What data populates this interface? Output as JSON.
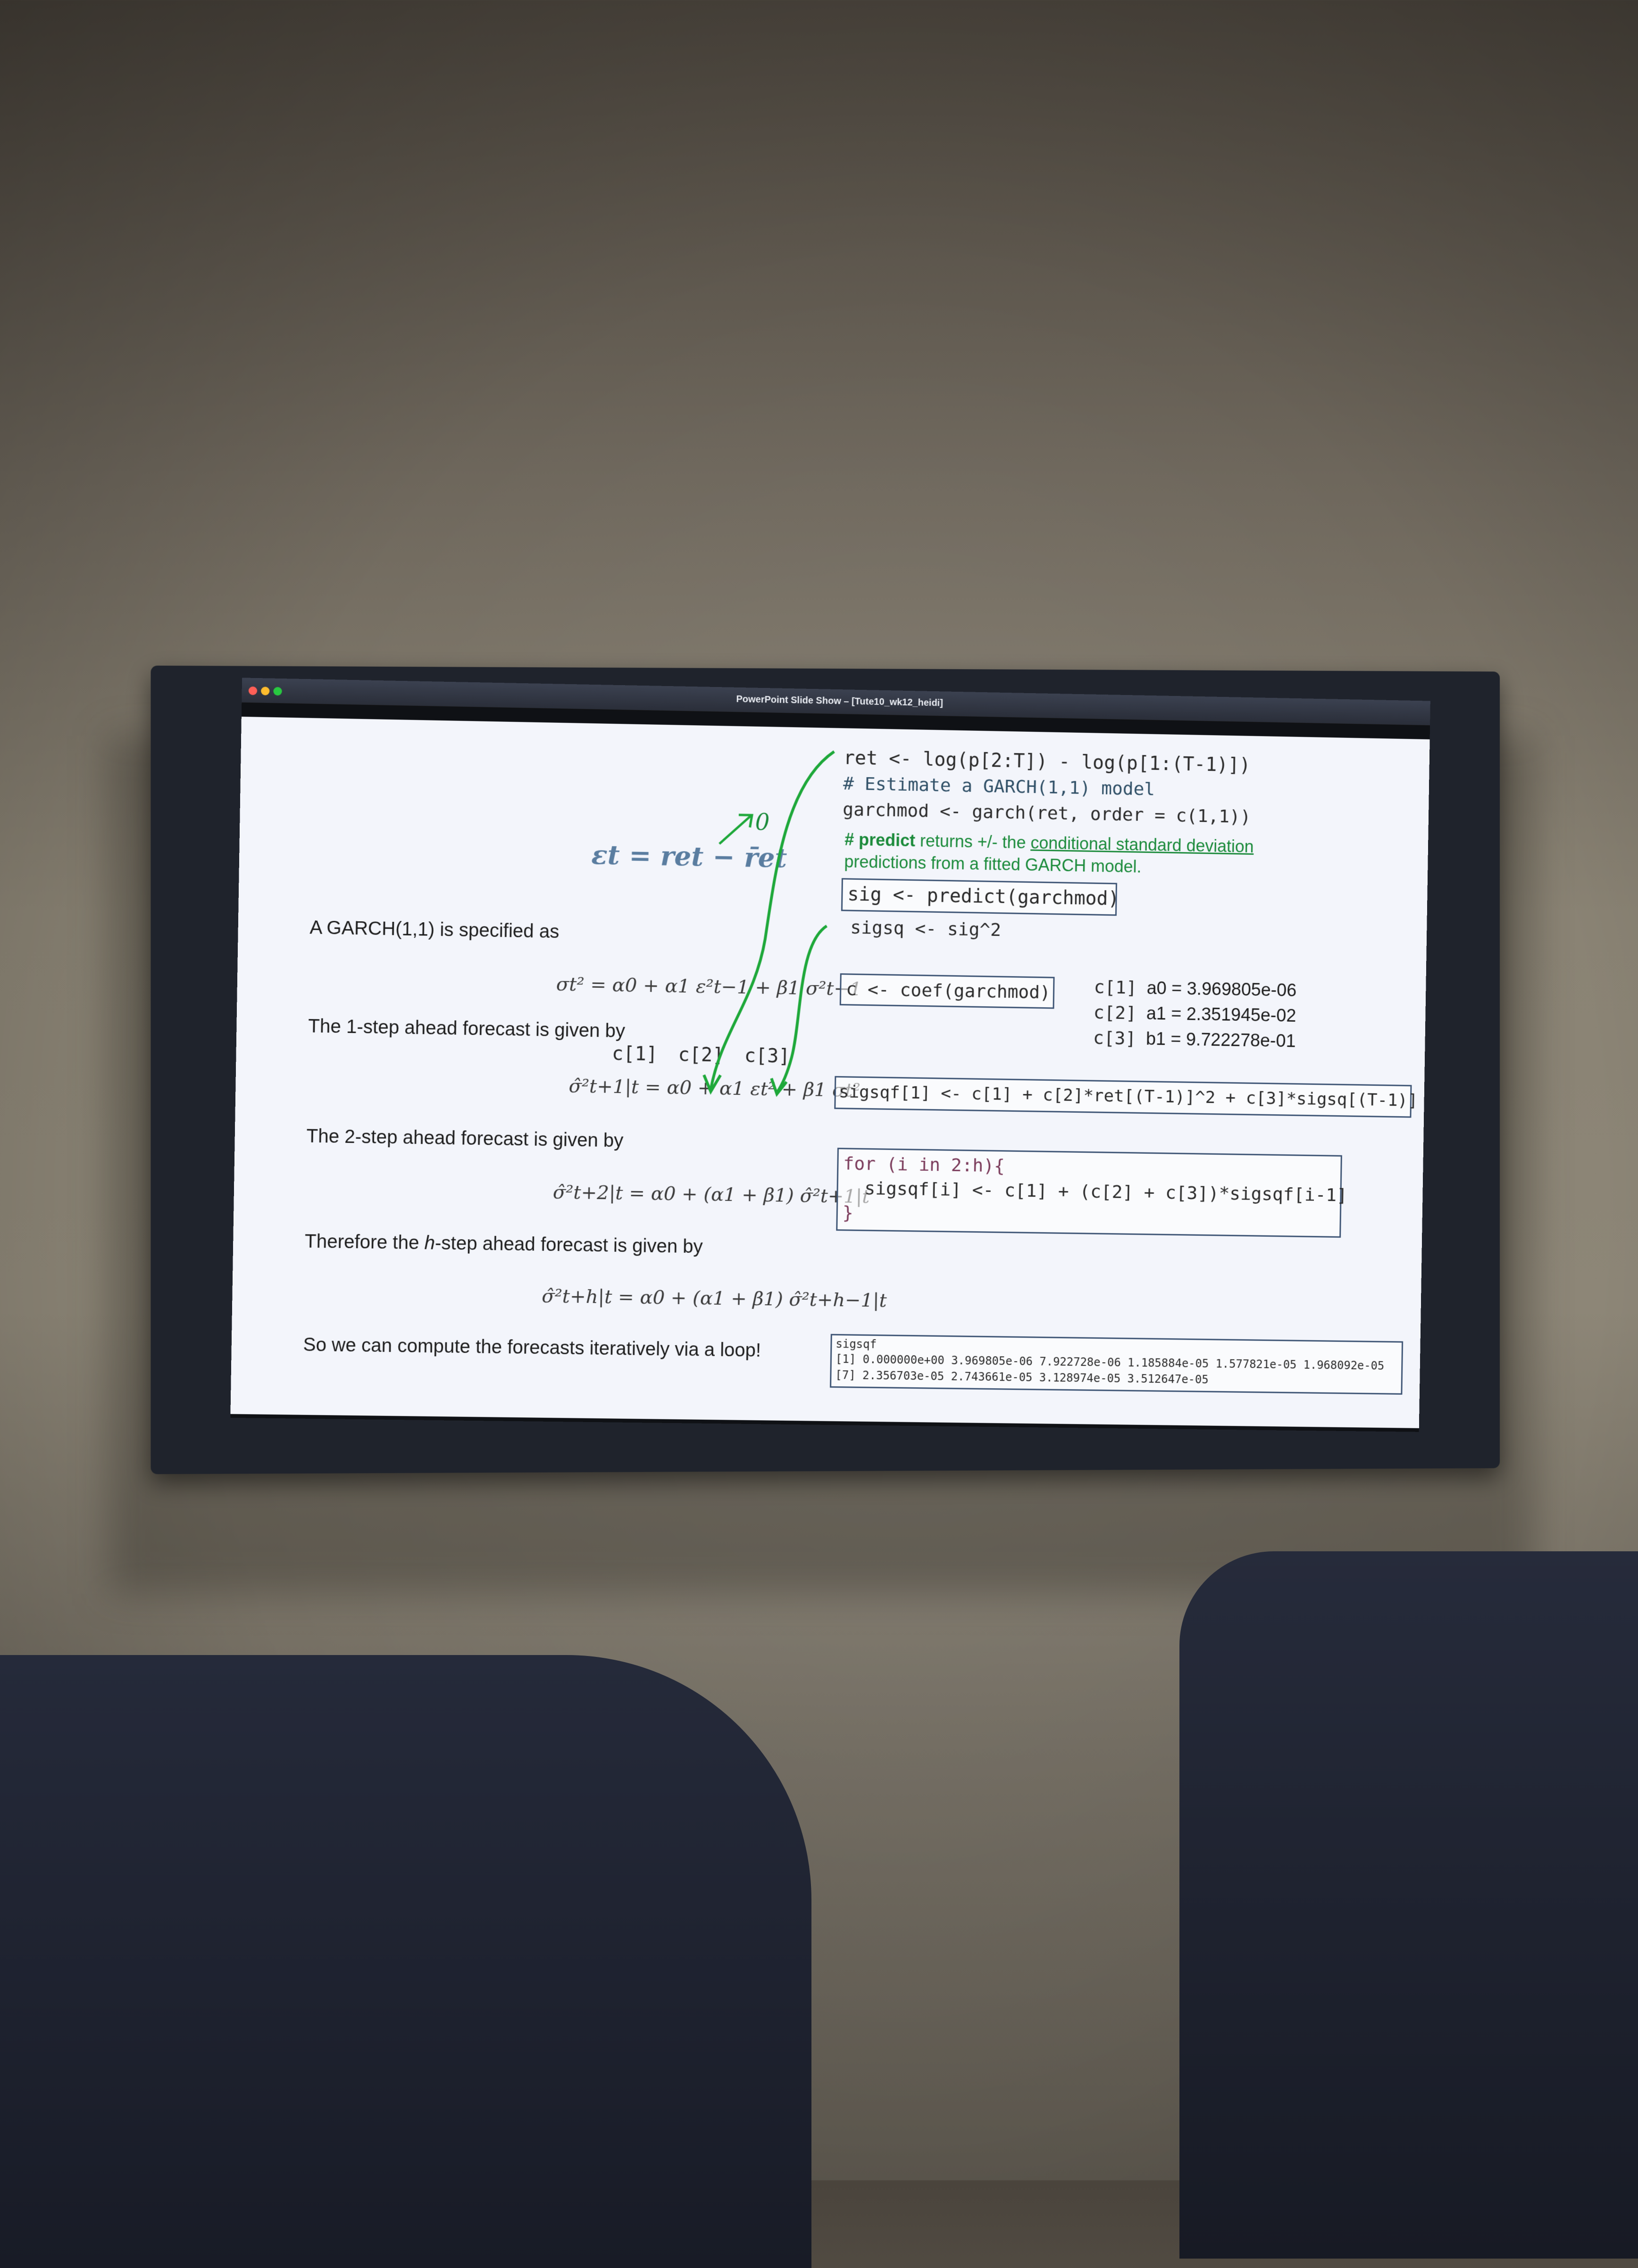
{
  "window": {
    "title": "PowerPoint Slide Show – [Tute10_wk12_heidi]"
  },
  "slide": {
    "left": {
      "residual_eq": "εt = ret − r̄et",
      "zero_annotation": "0",
      "garch_intro": "A GARCH(1,1) is specified as",
      "garch_eq": "σt² = α0 + α1 ε²t−1 + β1 σ²t−1",
      "one_step_intro": "The 1-step ahead forecast is given by",
      "coef_labels": [
        "c[1]",
        "c[2]",
        "c[3]"
      ],
      "one_step_eq": "σ̂²t+1|t = α0 + α1 εt² + β1 σt²",
      "two_step_intro": "The 2-step ahead forecast is given by",
      "two_step_eq": "σ̂²t+2|t = α0 + (α1 + β1) σ̂²t+1|t",
      "h_step_intro_pre": "Therefore the ",
      "h_step_intro_h": "h",
      "h_step_intro_post": "-step ahead forecast is given by",
      "h_step_eq": "σ̂²t+h|t = α0 + (α1 + β1) σ̂²t+h−1|t",
      "loop_text": "So we can compute the forecasts iteratively via a loop!"
    },
    "right": {
      "code_line1": "ret <- log(p[2:T]) - log(p[1:(T-1)])",
      "code_comment": "# Estimate a GARCH(1,1) model",
      "code_line3": "garchmod <- garch(ret, order = c(1,1))",
      "predict_comment_bold": "# predict",
      "predict_comment_mid": " returns +/- the ",
      "predict_comment_link": "conditional standard deviation",
      "predict_comment_line2": "predictions from a fitted GARCH model.",
      "predict_code": "sig <- predict(garchmod)",
      "sigsq_code": "sigsq <- sig^2",
      "coef_code": "c <- coef(garchmod)",
      "coef_values": [
        {
          "label": "c[1]",
          "value": "a0 = 3.969805e-06"
        },
        {
          "label": "c[2]",
          "value": "a1 = 2.351945e-02"
        },
        {
          "label": "c[3]",
          "value": "b1 = 9.722278e-01"
        }
      ],
      "sigsqf1_code": "sigsqf[1] <- c[1] + c[2]*ret[(T-1)]^2 + c[3]*sigsq[(T-1)]",
      "loop_line1": "for (i in 2:h){",
      "loop_line2": "  sigsqf[i] <- c[1] + (c[2] + c[3])*sigsqf[i-1]",
      "loop_line3": "}",
      "output_header": "sigsqf",
      "output_line1": "[1] 0.000000e+00 3.969805e-06 7.922728e-06 1.185884e-05 1.577821e-05 1.968092e-05",
      "output_line2": "[7] 2.356703e-05 2.743661e-05 3.128974e-05 3.512647e-05"
    }
  },
  "colors": {
    "annotation_green": "#1ea83a",
    "code_border": "#3e5575",
    "slide_bg": "#f3f5fb"
  }
}
